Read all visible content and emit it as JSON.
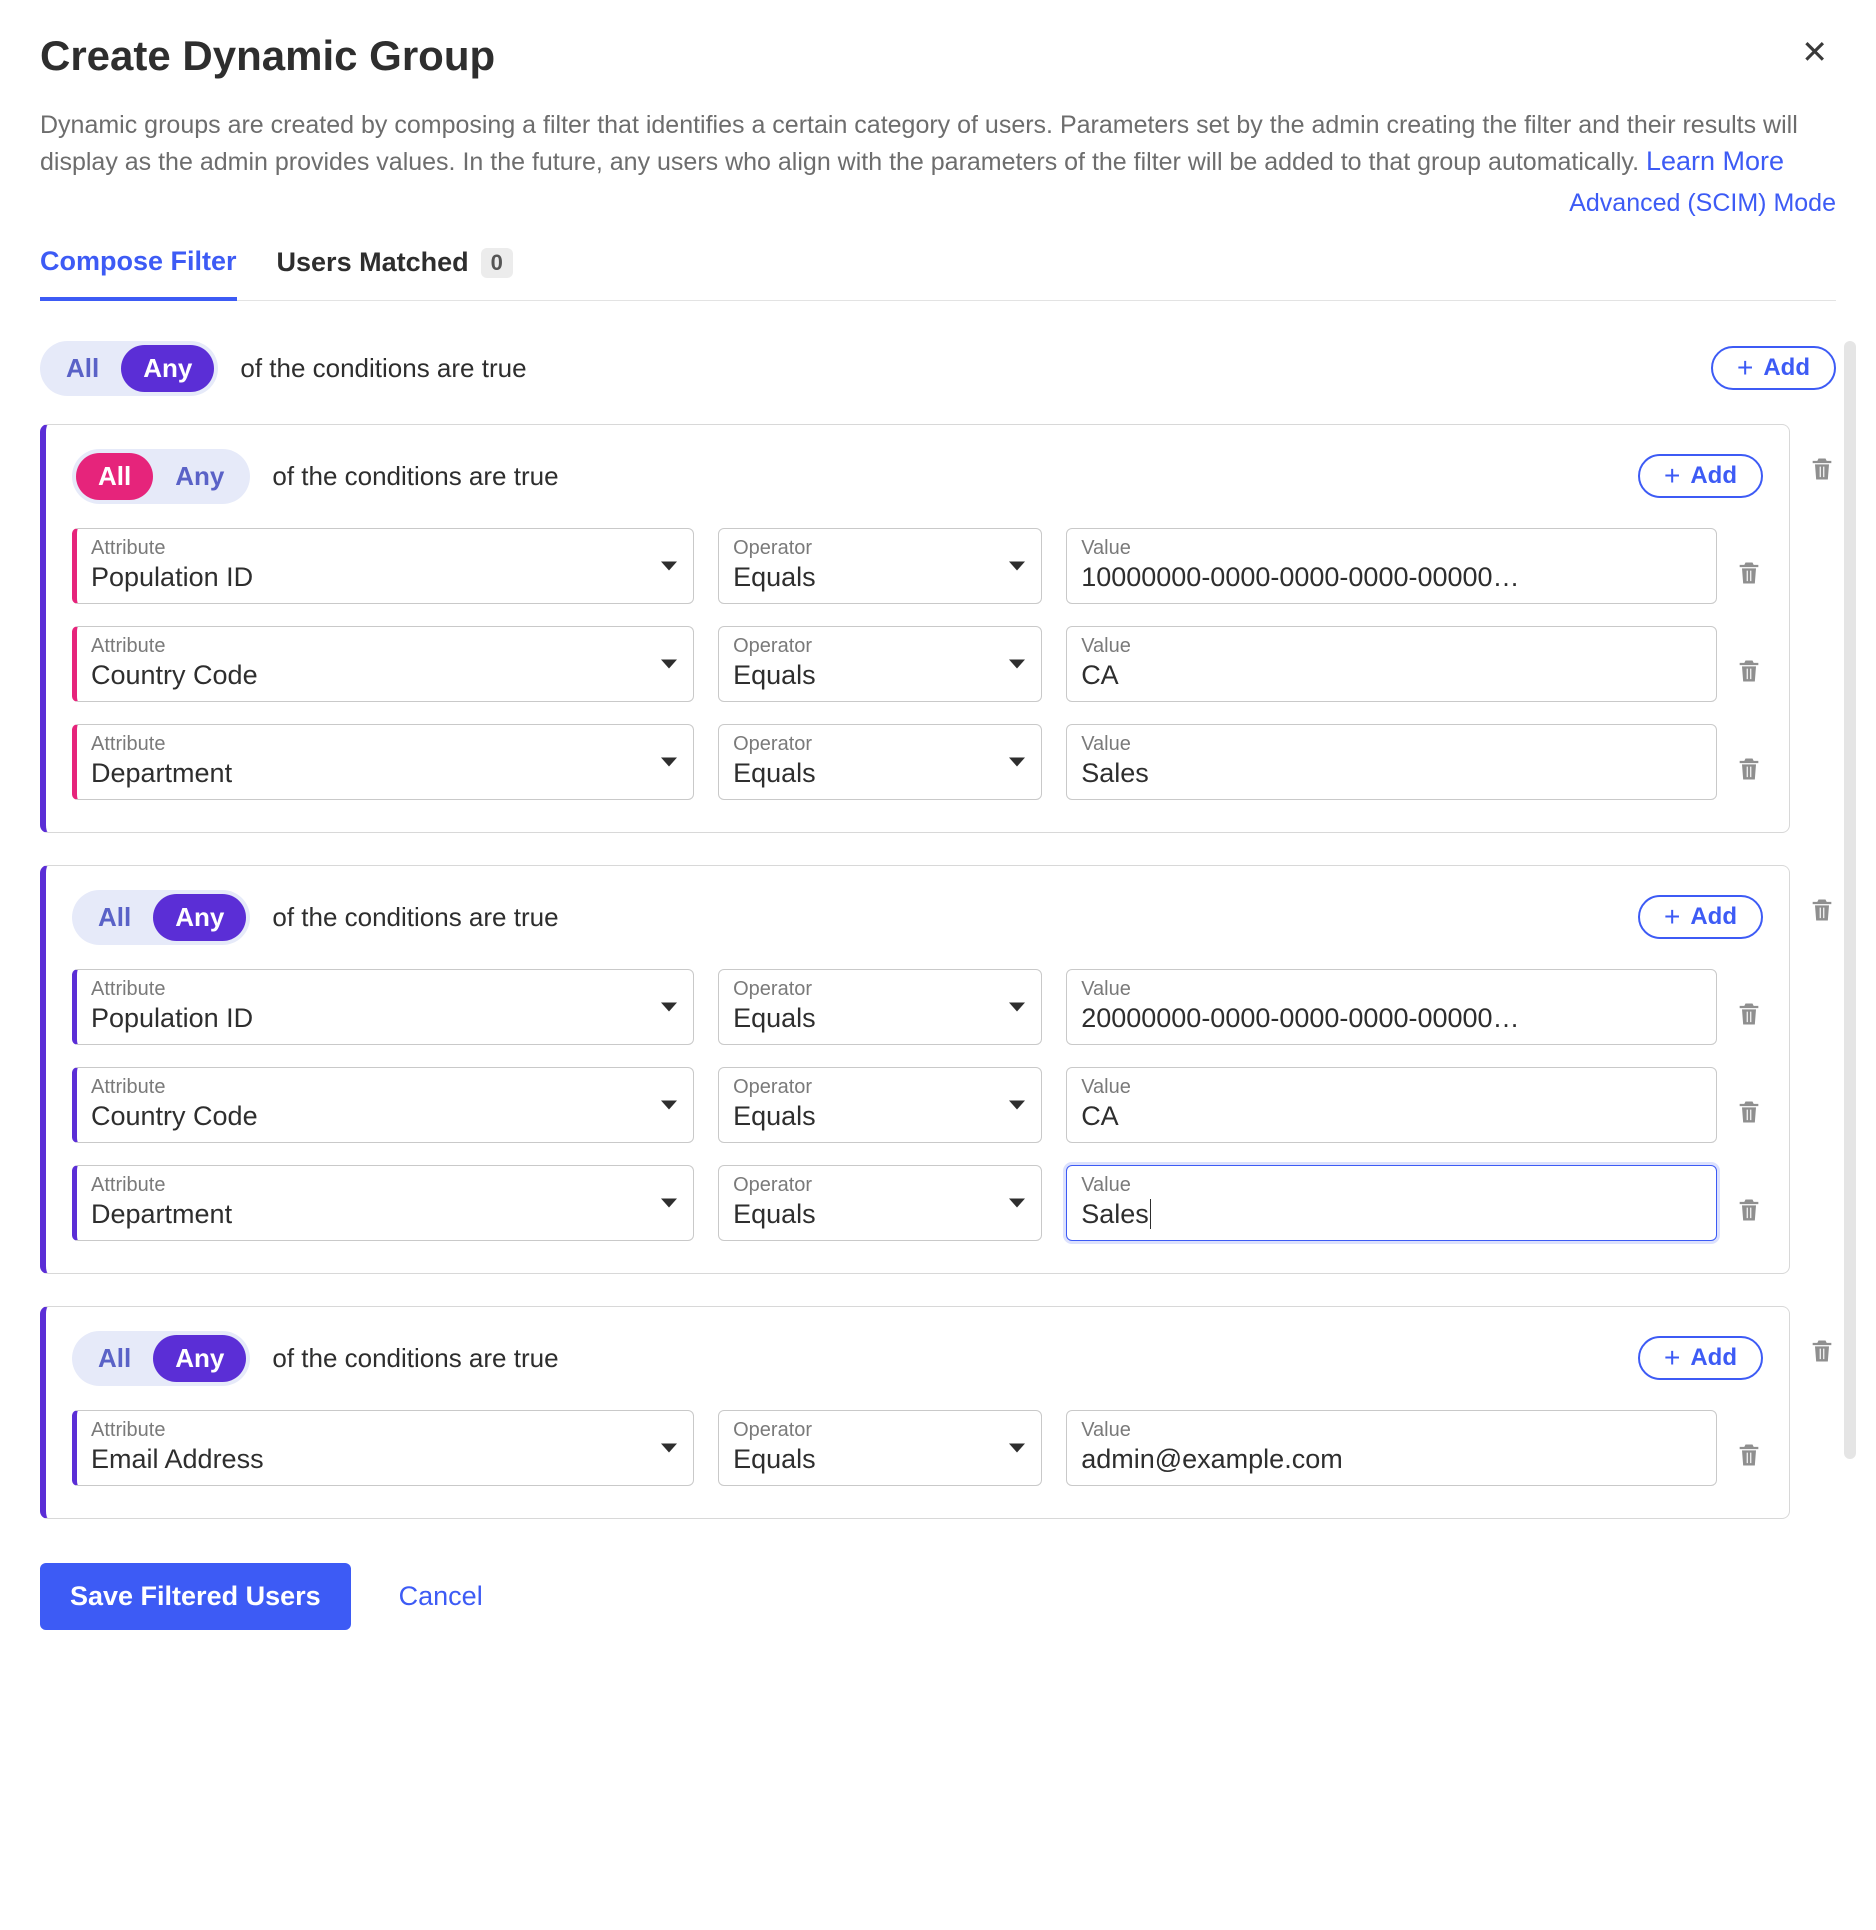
{
  "dialog": {
    "title": "Create Dynamic Group",
    "description": "Dynamic groups are created by composing a filter that identifies a certain category of users. Parameters set by the admin creating the filter and their results will display as the admin provides values. In the future, any users who align with the parameters of the filter will be added to that group automatically. ",
    "learnMore": "Learn More",
    "advancedMode": "Advanced (SCIM) Mode"
  },
  "tabs": {
    "compose": "Compose Filter",
    "matched": "Users Matched",
    "matchedCount": "0"
  },
  "labels": {
    "attribute": "Attribute",
    "operator": "Operator",
    "value": "Value",
    "all": "All",
    "any": "Any",
    "conditionsText": "of the conditions are true",
    "add": "Add"
  },
  "top": {
    "selected": "any"
  },
  "groups": [
    {
      "selected": "all",
      "accent": "pink",
      "conditions": [
        {
          "attribute": "Population ID",
          "operator": "Equals",
          "value": "10000000-0000-0000-0000-00000…",
          "focused": false
        },
        {
          "attribute": "Country Code",
          "operator": "Equals",
          "value": "CA",
          "focused": false
        },
        {
          "attribute": "Department",
          "operator": "Equals",
          "value": "Sales",
          "focused": false
        }
      ]
    },
    {
      "selected": "any",
      "accent": "purple",
      "conditions": [
        {
          "attribute": "Population ID",
          "operator": "Equals",
          "value": "20000000-0000-0000-0000-00000…",
          "focused": false
        },
        {
          "attribute": "Country Code",
          "operator": "Equals",
          "value": "CA",
          "focused": false
        },
        {
          "attribute": "Department",
          "operator": "Equals",
          "value": "Sales",
          "focused": true
        }
      ]
    },
    {
      "selected": "any",
      "accent": "purple",
      "conditions": [
        {
          "attribute": "Email Address",
          "operator": "Equals",
          "value": "admin@example.com",
          "focused": false
        }
      ]
    }
  ],
  "footer": {
    "save": "Save Filtered Users",
    "cancel": "Cancel"
  }
}
